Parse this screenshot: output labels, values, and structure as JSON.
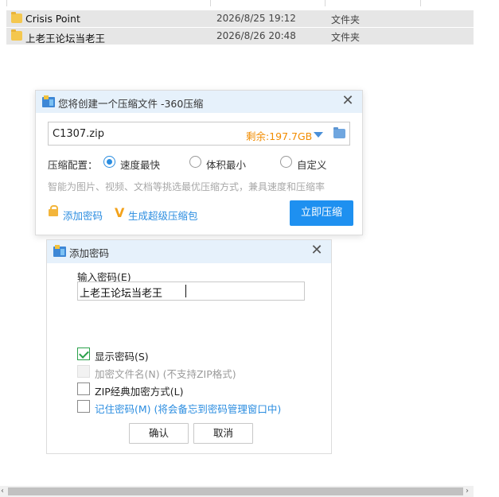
{
  "files": [
    {
      "name": "Crisis Point",
      "date": "2026/8/25 19:12",
      "type": "文件夹"
    },
    {
      "name": "上老王论坛当老王",
      "date": "2026/8/26 20:48",
      "type": "文件夹"
    }
  ],
  "compress_dialog": {
    "title": "您将创建一个压缩文件 -360压缩",
    "close_glyph": "✕",
    "path_value": "C1307.zip",
    "free_space": "剩余:197.7GB",
    "config_label": "压缩配置：",
    "options": [
      {
        "label": "速度最快",
        "selected": true
      },
      {
        "label": "体积最小",
        "selected": false
      },
      {
        "label": "自定义",
        "selected": false
      }
    ],
    "hint": "智能为图片、视频、文档等挑选最优压缩方式，兼具速度和压缩率",
    "add_password": "添加密码",
    "super_zip": "生成超级压缩包",
    "super_zip_mark": "V",
    "compress_button": "立即压缩",
    "accent_color": "#1e90f0"
  },
  "password_dialog": {
    "title": "添加密码",
    "close_glyph": "✕",
    "input_label": "输入密码(E)",
    "input_value": "上老王论坛当老王",
    "checkboxes": [
      {
        "label": "显示密码(S)",
        "checked": true,
        "disabled": false
      },
      {
        "label": "加密文件名(N) (不支持ZIP格式)",
        "checked": false,
        "disabled": true
      },
      {
        "label": "ZIP经典加密方式(L)",
        "checked": false,
        "disabled": false
      },
      {
        "label": "记住密码(M) (将会备忘到密码管理窗口中)",
        "checked": false,
        "disabled": false
      }
    ],
    "ok_button": "确认",
    "cancel_button": "取消"
  },
  "scrollbar": {
    "left_arrow": "‹",
    "right_arrow": "›"
  }
}
